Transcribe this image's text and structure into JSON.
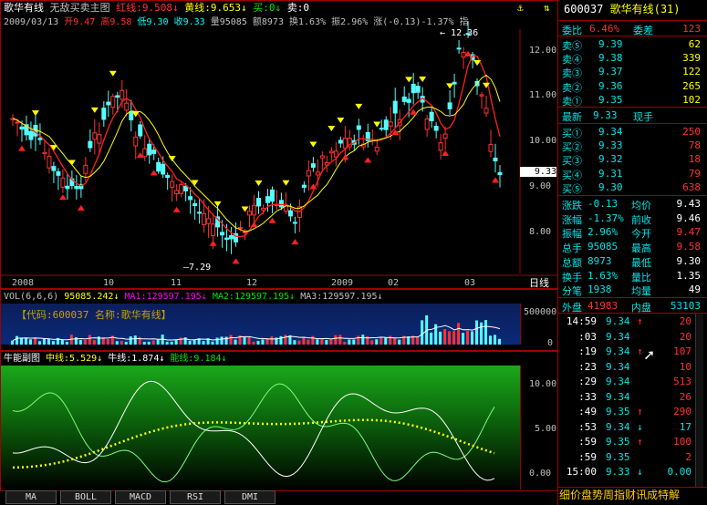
{
  "header": {
    "stock_name": "歌华有线",
    "chart_title": "无敌买卖主图",
    "red_line": "红线:9.508",
    "yellow_line": "黄线:9.653",
    "buy": "买:0",
    "sell": "卖:0",
    "date": "2009/03/13",
    "open": "开9.47",
    "high": "高9.58",
    "low": "低9.30",
    "close": "收9.33",
    "volume": "量95085",
    "amount": "额8973",
    "turnover": "换1.63%",
    "amplitude": "振2.96%",
    "change": "涨(-0.13)-1.37%",
    "trailing": "指"
  },
  "main_chart": {
    "y_ticks": [
      "12.00",
      "11.00",
      "10.00",
      "9.00",
      "8.00"
    ],
    "price_tag": "9.33",
    "high_label": "12.36",
    "low_label": "7.29",
    "x_labels": [
      "2008",
      "10",
      "11",
      "12",
      "2009",
      "02",
      "03"
    ],
    "period": "日线"
  },
  "vol_chart": {
    "title": "VOL(6,6,6)",
    "value": "95085.242",
    "ma1": "MA1:129597.195",
    "ma2": "MA2:129597.195",
    "ma3": "MA3:129597.195",
    "info_box": "【代码:600037 名称:歌华有线】",
    "y_ticks": [
      "500000",
      "0"
    ]
  },
  "energy_chart": {
    "title": "牛能副图",
    "mid_line": "中线:5.529",
    "bull_line": "牛线:1.874",
    "energy_line": "能线:9.184",
    "y_ticks": [
      "10.00",
      "5.00",
      "0.00"
    ]
  },
  "tabs": [
    "MA",
    "BOLL",
    "MACD",
    "RSI",
    "DMI"
  ],
  "quote": {
    "code": "600037",
    "name": "歌华有线",
    "count": "(31)",
    "weibi_label": "委比",
    "weibi_value": "6.46%",
    "weicha_label": "委差",
    "weicha_value": "123",
    "sells": [
      {
        "label": "卖⑤",
        "price": "9.39",
        "vol": "62"
      },
      {
        "label": "卖④",
        "price": "9.38",
        "vol": "339"
      },
      {
        "label": "卖③",
        "price": "9.37",
        "vol": "122"
      },
      {
        "label": "卖②",
        "price": "9.36",
        "vol": "265"
      },
      {
        "label": "卖①",
        "price": "9.35",
        "vol": "102"
      }
    ],
    "latest_label": "最新",
    "latest_value": "9.33",
    "cur_label": "现手",
    "buys": [
      {
        "label": "买①",
        "price": "9.34",
        "vol": "250"
      },
      {
        "label": "买②",
        "price": "9.33",
        "vol": "78"
      },
      {
        "label": "买③",
        "price": "9.32",
        "vol": "18"
      },
      {
        "label": "买④",
        "price": "9.31",
        "vol": "79"
      },
      {
        "label": "买⑤",
        "price": "9.30",
        "vol": "638"
      }
    ],
    "stats": [
      {
        "l1": "涨跌",
        "v1": "-0.13",
        "l2": "均价",
        "v2": "9.43"
      },
      {
        "l1": "涨幅",
        "v1": "-1.37%",
        "l2": "前收",
        "v2": "9.46"
      },
      {
        "l1": "振幅",
        "v1": "2.96%",
        "l2": "今开",
        "v2": "9.47"
      },
      {
        "l1": "总手",
        "v1": "95085",
        "l2": "最高",
        "v2": "9.58"
      },
      {
        "l1": "总额",
        "v1": "8973",
        "l2": "最低",
        "v2": "9.30"
      },
      {
        "l1": "换手",
        "v1": "1.63%",
        "l2": "量比",
        "v2": "1.35"
      },
      {
        "l1": "分笔",
        "v1": "1938",
        "l2": "均量",
        "v2": "49"
      }
    ],
    "outer_label": "外盘",
    "outer_value": "41983",
    "inner_label": "内盘",
    "inner_value": "53103",
    "ticks": [
      {
        "time": "14:59",
        "price": "9.34",
        "vol": "20",
        "dir": "up"
      },
      {
        "time": ":03",
        "price": "9.34",
        "vol": "20",
        "dir": ""
      },
      {
        "time": ":19",
        "price": "9.34",
        "vol": "107",
        "dir": "up"
      },
      {
        "time": ":23",
        "price": "9.34",
        "vol": "10",
        "dir": ""
      },
      {
        "time": ":29",
        "price": "9.34",
        "vol": "513",
        "dir": ""
      },
      {
        "time": ":33",
        "price": "9.34",
        "vol": "26",
        "dir": ""
      },
      {
        "time": ":49",
        "price": "9.35",
        "vol": "290",
        "dir": "up"
      },
      {
        "time": ":53",
        "price": "9.34",
        "vol": "17",
        "dir": "down"
      },
      {
        "time": ":59",
        "price": "9.35",
        "vol": "100",
        "dir": "up"
      },
      {
        "time": ":59",
        "price": "9.35",
        "vol": "2",
        "dir": ""
      },
      {
        "time": "15:00",
        "price": "9.33",
        "vol": "0.00",
        "dir": "down"
      }
    ],
    "bottom_banner": "细价盘势周指财讯成特解"
  },
  "colors": {
    "up": "#ff3232",
    "down": "#00ffff",
    "ma_yellow": "#ffff00",
    "ma_red": "#ff2020",
    "frame": "#a00000"
  }
}
